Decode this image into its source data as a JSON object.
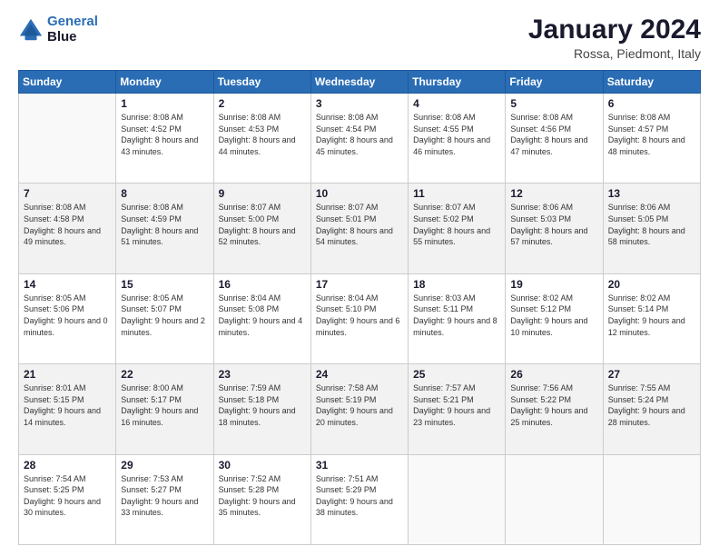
{
  "logo": {
    "line1": "General",
    "line2": "Blue"
  },
  "title": "January 2024",
  "subtitle": "Rossa, Piedmont, Italy",
  "days_header": [
    "Sunday",
    "Monday",
    "Tuesday",
    "Wednesday",
    "Thursday",
    "Friday",
    "Saturday"
  ],
  "weeks": [
    [
      {
        "day": "",
        "sunrise": "",
        "sunset": "",
        "daylight": ""
      },
      {
        "day": "1",
        "sunrise": "Sunrise: 8:08 AM",
        "sunset": "Sunset: 4:52 PM",
        "daylight": "Daylight: 8 hours and 43 minutes."
      },
      {
        "day": "2",
        "sunrise": "Sunrise: 8:08 AM",
        "sunset": "Sunset: 4:53 PM",
        "daylight": "Daylight: 8 hours and 44 minutes."
      },
      {
        "day": "3",
        "sunrise": "Sunrise: 8:08 AM",
        "sunset": "Sunset: 4:54 PM",
        "daylight": "Daylight: 8 hours and 45 minutes."
      },
      {
        "day": "4",
        "sunrise": "Sunrise: 8:08 AM",
        "sunset": "Sunset: 4:55 PM",
        "daylight": "Daylight: 8 hours and 46 minutes."
      },
      {
        "day": "5",
        "sunrise": "Sunrise: 8:08 AM",
        "sunset": "Sunset: 4:56 PM",
        "daylight": "Daylight: 8 hours and 47 minutes."
      },
      {
        "day": "6",
        "sunrise": "Sunrise: 8:08 AM",
        "sunset": "Sunset: 4:57 PM",
        "daylight": "Daylight: 8 hours and 48 minutes."
      }
    ],
    [
      {
        "day": "7",
        "sunrise": "Sunrise: 8:08 AM",
        "sunset": "Sunset: 4:58 PM",
        "daylight": "Daylight: 8 hours and 49 minutes."
      },
      {
        "day": "8",
        "sunrise": "Sunrise: 8:08 AM",
        "sunset": "Sunset: 4:59 PM",
        "daylight": "Daylight: 8 hours and 51 minutes."
      },
      {
        "day": "9",
        "sunrise": "Sunrise: 8:07 AM",
        "sunset": "Sunset: 5:00 PM",
        "daylight": "Daylight: 8 hours and 52 minutes."
      },
      {
        "day": "10",
        "sunrise": "Sunrise: 8:07 AM",
        "sunset": "Sunset: 5:01 PM",
        "daylight": "Daylight: 8 hours and 54 minutes."
      },
      {
        "day": "11",
        "sunrise": "Sunrise: 8:07 AM",
        "sunset": "Sunset: 5:02 PM",
        "daylight": "Daylight: 8 hours and 55 minutes."
      },
      {
        "day": "12",
        "sunrise": "Sunrise: 8:06 AM",
        "sunset": "Sunset: 5:03 PM",
        "daylight": "Daylight: 8 hours and 57 minutes."
      },
      {
        "day": "13",
        "sunrise": "Sunrise: 8:06 AM",
        "sunset": "Sunset: 5:05 PM",
        "daylight": "Daylight: 8 hours and 58 minutes."
      }
    ],
    [
      {
        "day": "14",
        "sunrise": "Sunrise: 8:05 AM",
        "sunset": "Sunset: 5:06 PM",
        "daylight": "Daylight: 9 hours and 0 minutes."
      },
      {
        "day": "15",
        "sunrise": "Sunrise: 8:05 AM",
        "sunset": "Sunset: 5:07 PM",
        "daylight": "Daylight: 9 hours and 2 minutes."
      },
      {
        "day": "16",
        "sunrise": "Sunrise: 8:04 AM",
        "sunset": "Sunset: 5:08 PM",
        "daylight": "Daylight: 9 hours and 4 minutes."
      },
      {
        "day": "17",
        "sunrise": "Sunrise: 8:04 AM",
        "sunset": "Sunset: 5:10 PM",
        "daylight": "Daylight: 9 hours and 6 minutes."
      },
      {
        "day": "18",
        "sunrise": "Sunrise: 8:03 AM",
        "sunset": "Sunset: 5:11 PM",
        "daylight": "Daylight: 9 hours and 8 minutes."
      },
      {
        "day": "19",
        "sunrise": "Sunrise: 8:02 AM",
        "sunset": "Sunset: 5:12 PM",
        "daylight": "Daylight: 9 hours and 10 minutes."
      },
      {
        "day": "20",
        "sunrise": "Sunrise: 8:02 AM",
        "sunset": "Sunset: 5:14 PM",
        "daylight": "Daylight: 9 hours and 12 minutes."
      }
    ],
    [
      {
        "day": "21",
        "sunrise": "Sunrise: 8:01 AM",
        "sunset": "Sunset: 5:15 PM",
        "daylight": "Daylight: 9 hours and 14 minutes."
      },
      {
        "day": "22",
        "sunrise": "Sunrise: 8:00 AM",
        "sunset": "Sunset: 5:17 PM",
        "daylight": "Daylight: 9 hours and 16 minutes."
      },
      {
        "day": "23",
        "sunrise": "Sunrise: 7:59 AM",
        "sunset": "Sunset: 5:18 PM",
        "daylight": "Daylight: 9 hours and 18 minutes."
      },
      {
        "day": "24",
        "sunrise": "Sunrise: 7:58 AM",
        "sunset": "Sunset: 5:19 PM",
        "daylight": "Daylight: 9 hours and 20 minutes."
      },
      {
        "day": "25",
        "sunrise": "Sunrise: 7:57 AM",
        "sunset": "Sunset: 5:21 PM",
        "daylight": "Daylight: 9 hours and 23 minutes."
      },
      {
        "day": "26",
        "sunrise": "Sunrise: 7:56 AM",
        "sunset": "Sunset: 5:22 PM",
        "daylight": "Daylight: 9 hours and 25 minutes."
      },
      {
        "day": "27",
        "sunrise": "Sunrise: 7:55 AM",
        "sunset": "Sunset: 5:24 PM",
        "daylight": "Daylight: 9 hours and 28 minutes."
      }
    ],
    [
      {
        "day": "28",
        "sunrise": "Sunrise: 7:54 AM",
        "sunset": "Sunset: 5:25 PM",
        "daylight": "Daylight: 9 hours and 30 minutes."
      },
      {
        "day": "29",
        "sunrise": "Sunrise: 7:53 AM",
        "sunset": "Sunset: 5:27 PM",
        "daylight": "Daylight: 9 hours and 33 minutes."
      },
      {
        "day": "30",
        "sunrise": "Sunrise: 7:52 AM",
        "sunset": "Sunset: 5:28 PM",
        "daylight": "Daylight: 9 hours and 35 minutes."
      },
      {
        "day": "31",
        "sunrise": "Sunrise: 7:51 AM",
        "sunset": "Sunset: 5:29 PM",
        "daylight": "Daylight: 9 hours and 38 minutes."
      },
      {
        "day": "",
        "sunrise": "",
        "sunset": "",
        "daylight": ""
      },
      {
        "day": "",
        "sunrise": "",
        "sunset": "",
        "daylight": ""
      },
      {
        "day": "",
        "sunrise": "",
        "sunset": "",
        "daylight": ""
      }
    ]
  ]
}
